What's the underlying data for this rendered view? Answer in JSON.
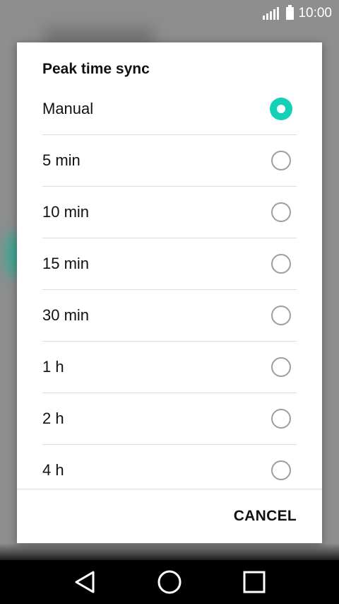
{
  "status_bar": {
    "time": "10:00",
    "icons": [
      "signal-icon",
      "battery-icon"
    ]
  },
  "dialog": {
    "title": "Peak time sync",
    "options": [
      {
        "label": "Manual",
        "selected": true
      },
      {
        "label": "5 min",
        "selected": false
      },
      {
        "label": "10 min",
        "selected": false
      },
      {
        "label": "15 min",
        "selected": false
      },
      {
        "label": "30 min",
        "selected": false
      },
      {
        "label": "1 h",
        "selected": false
      },
      {
        "label": "2 h",
        "selected": false
      },
      {
        "label": "4 h",
        "selected": false
      }
    ],
    "cancel_label": "CANCEL"
  },
  "nav_bar": {
    "icons": [
      "back-icon",
      "home-icon",
      "recents-icon"
    ]
  },
  "colors": {
    "accent": "#13d1b8",
    "dim_background": "#8e8e8e"
  }
}
